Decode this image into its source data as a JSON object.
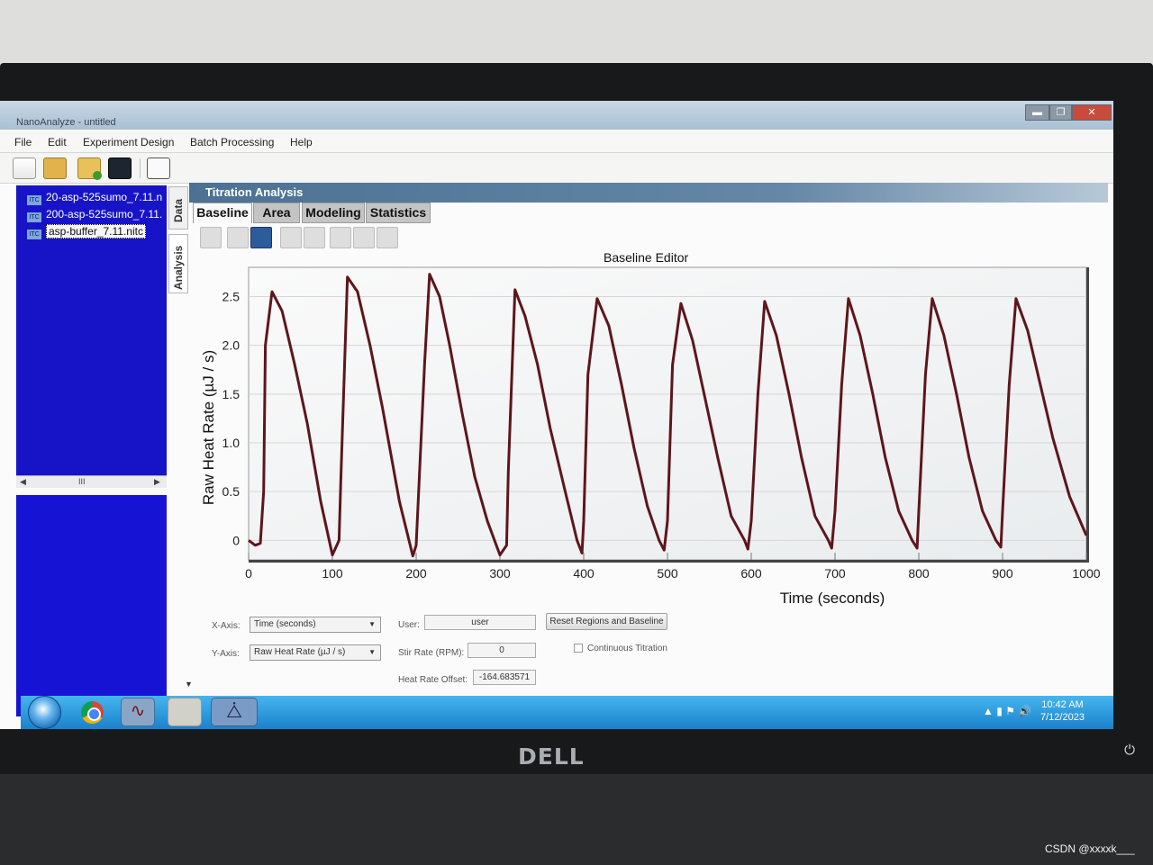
{
  "app": {
    "title": "NanoAnalyze - untitled",
    "window_controls": {
      "minimize": "▬",
      "maximize": "❐",
      "close": "✕"
    },
    "menu": [
      "File",
      "Edit",
      "Experiment Design",
      "Batch Processing",
      "Help"
    ],
    "toolbar_icons": [
      "new-file-icon",
      "open-folder-icon",
      "add-folder-icon",
      "save-icon",
      "edit-icon"
    ]
  },
  "files": {
    "items": [
      {
        "icon": "itc-file-icon",
        "name": "20-asp-525sumo_7.11.n"
      },
      {
        "icon": "itc-file-icon",
        "name": "200-asp-525sumo_7.11."
      },
      {
        "icon": "itc-file-icon",
        "name": "asp-buffer_7.11.nitc",
        "selected": true
      }
    ],
    "scroll_indicator": "III"
  },
  "side_tabs": [
    "Data",
    "Analysis"
  ],
  "analysis": {
    "panel_title": "Titration Analysis",
    "tabs": [
      "Baseline",
      "Area",
      "Modeling",
      "Statistics"
    ],
    "tools": [
      "zoom-icon",
      "chart-edit-icon",
      "baseline-icon",
      "add-point-icon",
      "remove-point-icon",
      "region-icon",
      "peak-icon",
      "fit-icon"
    ]
  },
  "chart_data": {
    "type": "line",
    "title": "Baseline Editor",
    "xlabel": "Time (seconds)",
    "ylabel": "Raw Heat Rate (µJ / s)",
    "xlim": [
      0,
      1000
    ],
    "ylim": [
      -0.2,
      2.8
    ],
    "x_ticks": [
      0,
      100,
      200,
      300,
      400,
      500,
      600,
      700,
      800,
      900,
      1000
    ],
    "y_ticks": [
      0,
      0.5,
      1.0,
      1.5,
      2.0,
      2.5
    ],
    "y_tick_labels": [
      "0",
      "0.5",
      "1.0",
      "1.5",
      "2.0",
      "2.5"
    ],
    "series": [
      {
        "color": "#5d161c",
        "x": [
          0,
          8,
          14,
          18,
          20,
          28,
          40,
          55,
          70,
          86,
          100,
          108,
          110,
          118,
          130,
          145,
          160,
          180,
          196,
          200,
          210,
          216,
          228,
          240,
          255,
          270,
          285,
          300,
          308,
          310,
          318,
          330,
          345,
          360,
          378,
          392,
          398,
          400,
          405,
          416,
          430,
          445,
          460,
          476,
          490,
          496,
          500,
          506,
          516,
          530,
          545,
          560,
          576,
          592,
          596,
          600,
          608,
          616,
          630,
          645,
          660,
          676,
          692,
          696,
          700,
          708,
          716,
          730,
          745,
          760,
          776,
          792,
          798,
          800,
          808,
          816,
          830,
          845,
          860,
          876,
          892,
          898,
          900,
          908,
          916,
          930,
          945,
          960,
          980,
          1000
        ],
        "y": [
          0.0,
          -0.05,
          -0.03,
          0.5,
          2.0,
          2.55,
          2.35,
          1.8,
          1.2,
          0.4,
          -0.15,
          0.0,
          0.6,
          2.7,
          2.55,
          2.0,
          1.35,
          0.4,
          -0.16,
          -0.05,
          1.8,
          2.73,
          2.5,
          2.0,
          1.3,
          0.65,
          0.2,
          -0.15,
          -0.05,
          0.7,
          2.57,
          2.3,
          1.8,
          1.15,
          0.5,
          0.0,
          -0.13,
          0.2,
          1.7,
          2.48,
          2.2,
          1.6,
          0.95,
          0.35,
          0.0,
          -0.1,
          0.2,
          1.8,
          2.43,
          2.05,
          1.45,
          0.85,
          0.25,
          0.0,
          -0.09,
          0.2,
          1.5,
          2.45,
          2.1,
          1.5,
          0.85,
          0.25,
          0.0,
          -0.08,
          0.3,
          1.6,
          2.48,
          2.1,
          1.5,
          0.85,
          0.3,
          0.0,
          -0.08,
          0.3,
          1.7,
          2.48,
          2.1,
          1.5,
          0.85,
          0.3,
          0.0,
          -0.07,
          0.3,
          1.6,
          2.48,
          2.15,
          1.6,
          1.05,
          0.45,
          0.05
        ]
      }
    ]
  },
  "controls": {
    "x_axis_label": "X-Axis:",
    "x_axis_value": "Time (seconds)",
    "y_axis_label": "Y-Axis:",
    "y_axis_value": "Raw Heat Rate (µJ / s)",
    "user_label": "User:",
    "user_value": "user",
    "stir_label": "Stir Rate (RPM):",
    "stir_value": "0",
    "heat_offset_label": "Heat Rate Offset:",
    "heat_offset_value": "-164.683571",
    "reset_button": "Reset Regions and Baseline",
    "continuous_label": "Continuous Titration",
    "continuous_checked": false,
    "dropdown_arrow": "▼"
  },
  "taskbar": {
    "apps": [
      "windows-start-icon",
      "chrome-icon",
      "nanoanalyze-chart-icon",
      "folder-icon",
      "nanoanalyze-active-icon"
    ],
    "time": "10:42 AM",
    "date": "7/12/2023",
    "tray_icons": [
      "tray-arrow-icon",
      "network-icon",
      "action-center-icon",
      "volume-icon"
    ]
  },
  "monitor": {
    "brand": "DELL",
    "power_icon": "power-icon"
  },
  "watermark": "CSDN @xxxxk___"
}
